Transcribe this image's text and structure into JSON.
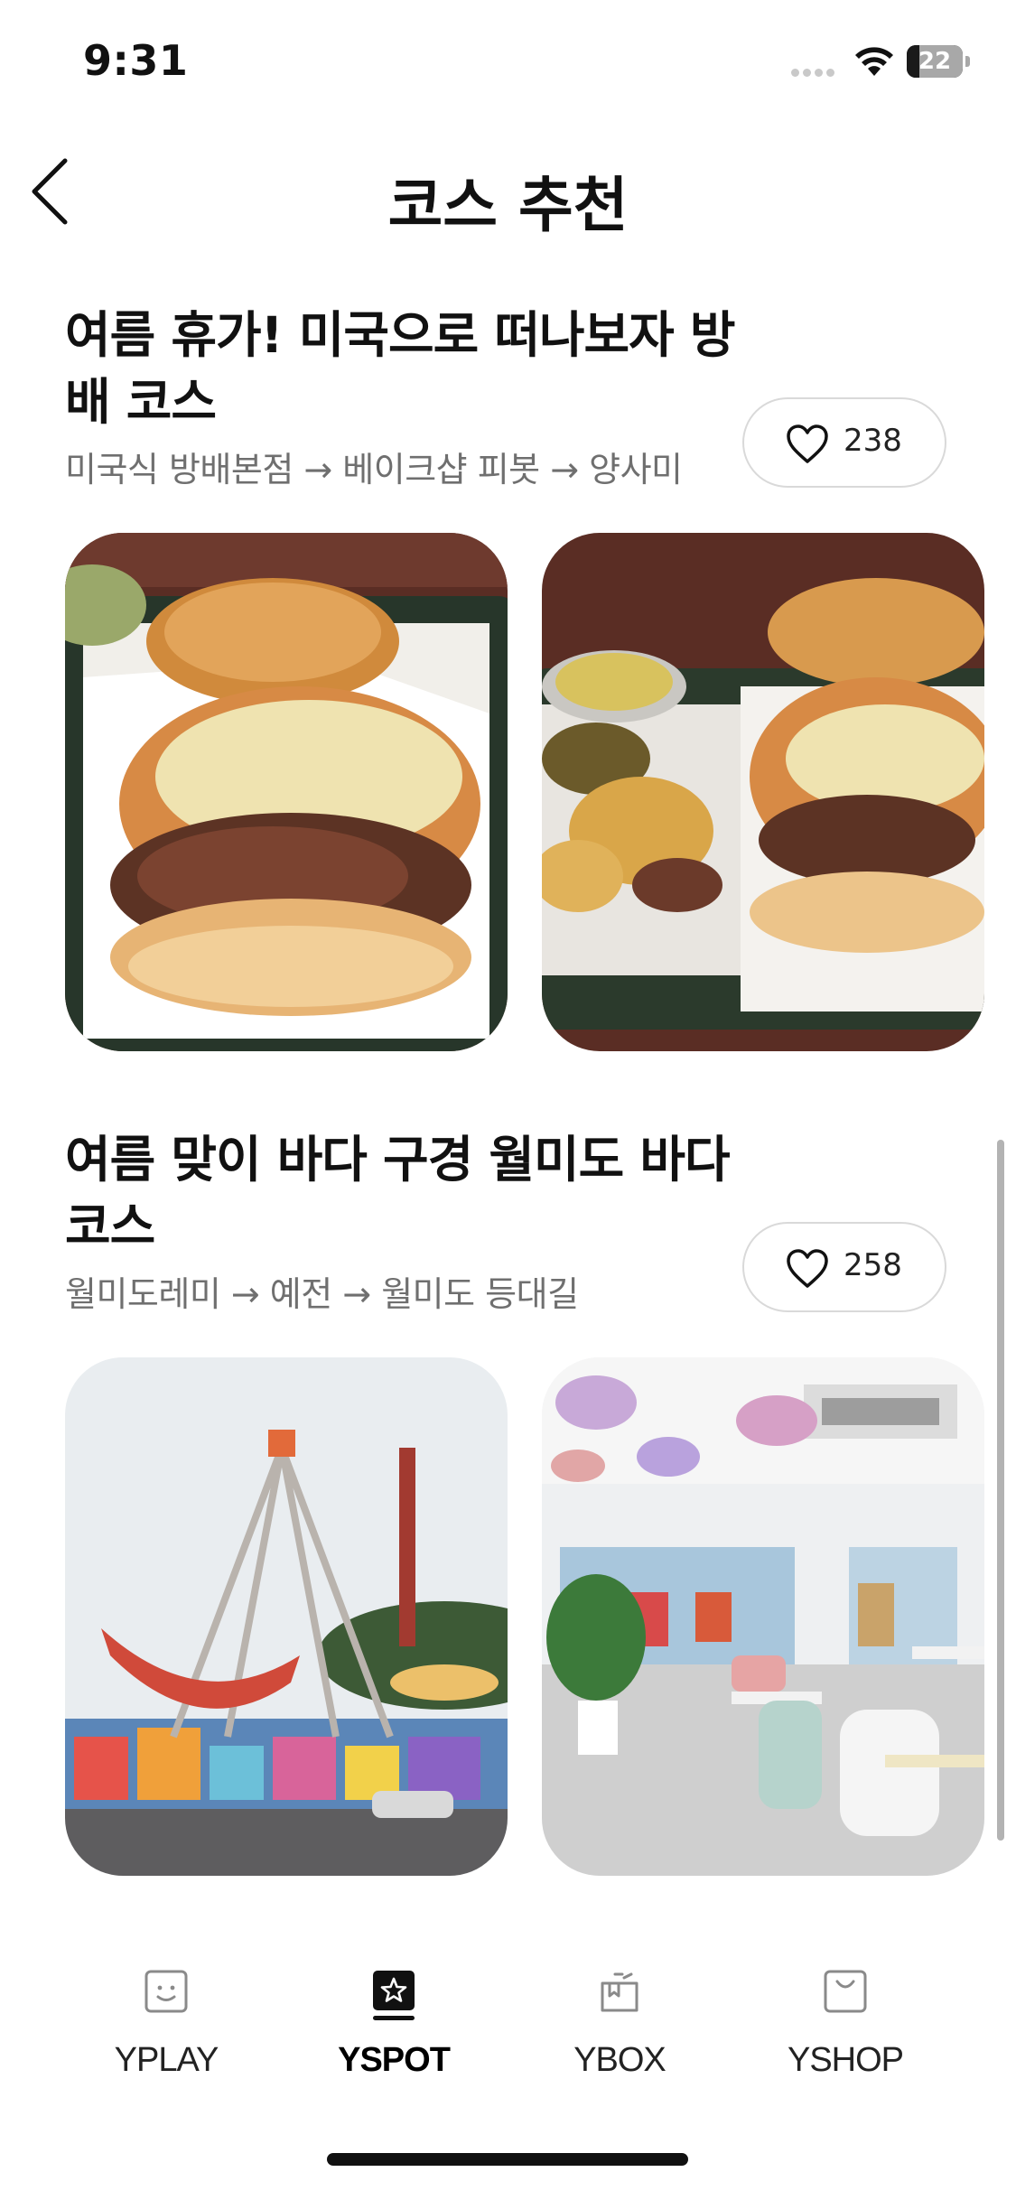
{
  "status_bar": {
    "time": "9:31",
    "battery_level": "22",
    "battery_fraction": 0.22,
    "icons": [
      "signal-icon",
      "wifi-icon",
      "battery-icon"
    ]
  },
  "header": {
    "title": "코스 추천",
    "back_icon": "chevron-left-icon"
  },
  "courses": [
    {
      "title": "여름 휴가! 미국으로 떠나보자 방배 코스",
      "route": "미국식 방배본점 → 베이크샵 피봇 → 양사미",
      "likes": "238",
      "photos": [
        "burger-photo",
        "burger-fries-photo"
      ]
    },
    {
      "title": "여름 맞이 바다 구경 월미도 바다 코스",
      "route": "월미도레미 → 예전 → 월미도 등대길",
      "likes": "258",
      "photos": [
        "amusement-park-photo",
        "cafe-interior-photo"
      ]
    }
  ],
  "tab_bar": {
    "tabs": [
      {
        "label": "YPLAY",
        "icon": "smile-box-icon",
        "active": false
      },
      {
        "label": "YSPOT",
        "icon": "star-box-icon",
        "active": true
      },
      {
        "label": "YBOX",
        "icon": "gift-box-icon",
        "active": false
      },
      {
        "label": "YSHOP",
        "icon": "shopping-bag-icon",
        "active": false
      }
    ]
  },
  "colors": {
    "text": "#111111",
    "route_text": "#6f6f6f",
    "border": "#d9d9d9",
    "tab_inactive_icon": "#8a8a8a"
  }
}
